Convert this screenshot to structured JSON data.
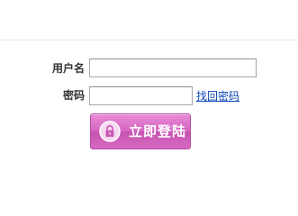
{
  "login_form": {
    "username_label": "用户名",
    "username_value": "",
    "password_label": "密码",
    "password_value": "",
    "recover_password_link": "找回密码",
    "submit_label": "立即登陆"
  },
  "colors": {
    "button_primary": "#d766c1",
    "button_border": "#b44ca4",
    "link": "#0c46b8",
    "divider": "#e6e6e6"
  },
  "icons": {
    "submit_icon": "lock-icon"
  }
}
